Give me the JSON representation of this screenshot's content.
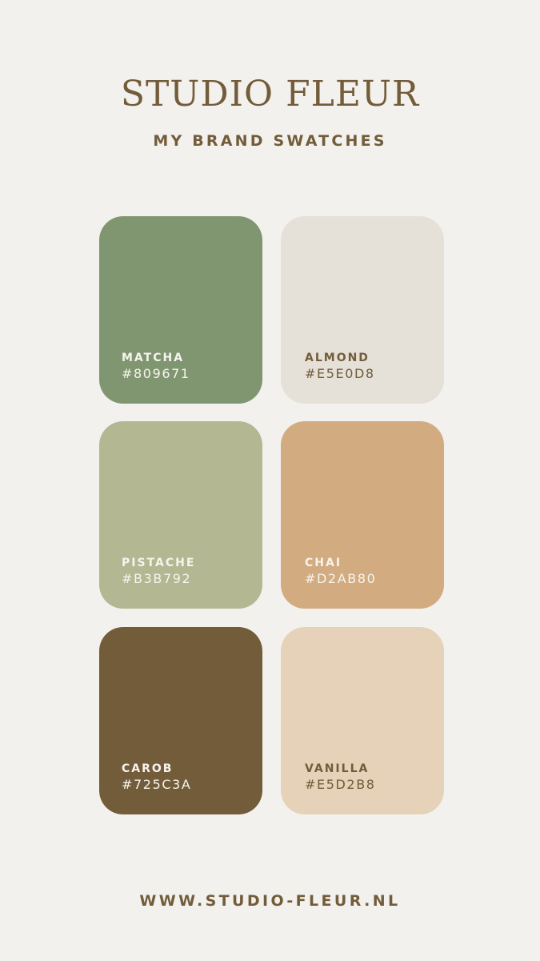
{
  "header": {
    "title": "STUDIO FLEUR",
    "subtitle": "MY BRAND SWATCHES"
  },
  "swatches": [
    {
      "name": "MATCHA",
      "hex_label": "#809671",
      "color": "#809671",
      "text_color": "#f7f4ee"
    },
    {
      "name": "ALMOND",
      "hex_label": "#E5E0D8",
      "color": "#e5e0d8",
      "text_color": "#725c3a"
    },
    {
      "name": "PISTACHE",
      "hex_label": "#B3B792",
      "color": "#b3b792",
      "text_color": "#f7f4ee"
    },
    {
      "name": "CHAI",
      "hex_label": "#D2AB80",
      "color": "#d2ab80",
      "text_color": "#f7f4ee"
    },
    {
      "name": "CAROB",
      "hex_label": "#725C3A",
      "color": "#725c3a",
      "text_color": "#f7f4ee"
    },
    {
      "name": "VANILLA",
      "hex_label": "#E5D2B8",
      "color": "#e5d2b8",
      "text_color": "#725c3a"
    }
  ],
  "footer": {
    "url": "WWW.STUDIO-FLEUR.NL"
  },
  "colors": {
    "background": "#f3f1ed",
    "text_brown": "#725c3a"
  }
}
